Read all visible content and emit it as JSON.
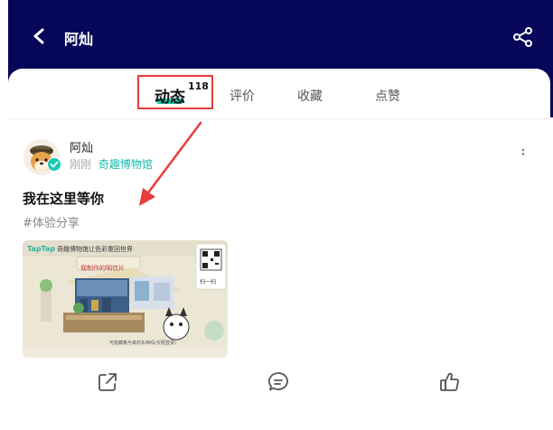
{
  "header": {
    "title": "阿灿",
    "back_icon": "chevron-left-icon",
    "share_icon": "share-icon",
    "background": "#07075a"
  },
  "tabs": {
    "items": [
      {
        "label": "动态",
        "count": "118",
        "active": true
      },
      {
        "label": "评价",
        "active": false
      },
      {
        "label": "收藏",
        "active": false
      },
      {
        "label": "点赞",
        "active": false
      }
    ],
    "accent": "#19c9b4",
    "highlight_color": "#e63c3c"
  },
  "post": {
    "author": "阿灿",
    "time": "刚刚",
    "source": "奇趣博物馆",
    "title": "我在这里等你",
    "tag": "#体验分享",
    "image": {
      "brand": "TapTap",
      "banner": "奇趣博物馆让色彩重回世界",
      "subtitle": "我制作的明信片",
      "qr_label": "扫一扫",
      "caption": "可能藏着与真的东西吗(仅限登录)"
    },
    "actions": [
      {
        "name": "share",
        "icon": "share-arrow-icon"
      },
      {
        "name": "comment",
        "icon": "comment-icon"
      },
      {
        "name": "like",
        "icon": "thumbs-up-icon"
      }
    ]
  }
}
